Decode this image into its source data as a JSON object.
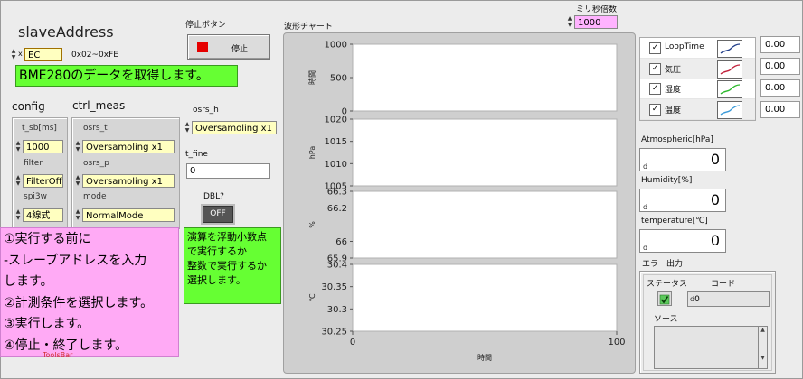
{
  "title": "slaveAddress",
  "address": {
    "value": "EC",
    "range": "0x02~0xFE"
  },
  "banner": "BME280のデータを取得します。",
  "stop": {
    "label": "停止ボタン",
    "button": "停止"
  },
  "chart_label": "波形チャート",
  "ms_multiplier": {
    "label": "ミリ秒倍数",
    "value": "1000"
  },
  "config": {
    "header": "config",
    "t_sb_label": "t_sb[ms]",
    "t_sb_value": "1000",
    "filter_label": "filter",
    "filter_value": "FilterOff",
    "spi3w_label": "spi3w",
    "spi3w_value": "4線式"
  },
  "ctrl_meas": {
    "header": "ctrl_meas",
    "osrs_t_label": "osrs_t",
    "osrs_t_value": "Oversamoling x1",
    "osrs_p_label": "osrs_p",
    "osrs_p_value": "Oversamoling x1",
    "mode_label": "mode",
    "mode_value": "NormalMode"
  },
  "osrs_h": {
    "label": "osrs_h",
    "value": "Oversamoling x1"
  },
  "t_fine": {
    "label": "t_fine",
    "value": "0"
  },
  "dbl": {
    "label": "DBL?",
    "button": "OFF"
  },
  "float_note": [
    "演算を浮動小数点",
    "で実行するか",
    "整数で実行するか",
    "選択します。"
  ],
  "instructions": [
    "①実行する前に",
    "-スレーブアドレスを入力",
    "します。",
    "②計測条件を選択します。",
    "③実行します。",
    "④停止・終了します。"
  ],
  "toolbar_text": "ToolsBar",
  "colors": {
    "loop": "#1f3c88",
    "pressure": "#c0203a",
    "humidity": "#2bb82b",
    "temperature": "#3a9ad9"
  },
  "legend": [
    {
      "name": "LoopTime",
      "value": "0.00",
      "color_key": "loop"
    },
    {
      "name": "気圧",
      "value": "0.00",
      "color_key": "pressure"
    },
    {
      "name": "湿度",
      "value": "0.00",
      "color_key": "humidity"
    },
    {
      "name": "温度",
      "value": "0.00",
      "color_key": "temperature"
    }
  ],
  "indicators": {
    "atmospheric": {
      "label": "Atmospheric[hPa]",
      "value": "0"
    },
    "humidity": {
      "label": "Humidity[%]",
      "value": "0"
    },
    "temperature": {
      "label": "temperature[℃]",
      "value": "0"
    }
  },
  "error": {
    "title": "エラー出力",
    "status_label": "ステータス",
    "code_label": "コード",
    "code_value": "0",
    "source_label": "ソース"
  },
  "d_tag": "d",
  "chart_data": [
    {
      "type": "line",
      "ylabel": "時間",
      "ylim": [
        0,
        1000
      ],
      "yticks": [
        "1000",
        "500",
        "0"
      ],
      "series": []
    },
    {
      "type": "line",
      "ylabel": "hPa",
      "ylim": [
        1005,
        1020
      ],
      "yticks": [
        "1020",
        "1015",
        "1010",
        "1005"
      ],
      "series": []
    },
    {
      "type": "line",
      "ylabel": "%",
      "ylim": [
        65.9,
        66.3
      ],
      "yticks": [
        "66.3",
        "66.2",
        "66",
        "65.9"
      ],
      "series": []
    },
    {
      "type": "line",
      "ylabel": "℃",
      "ylim": [
        30.25,
        30.4
      ],
      "yticks": [
        "30.4",
        "30.35",
        "30.3",
        "30.25"
      ],
      "series": []
    }
  ],
  "x_axis": {
    "label": "時間",
    "ticks": [
      "0",
      "100"
    ],
    "xlim": [
      0,
      100
    ]
  }
}
